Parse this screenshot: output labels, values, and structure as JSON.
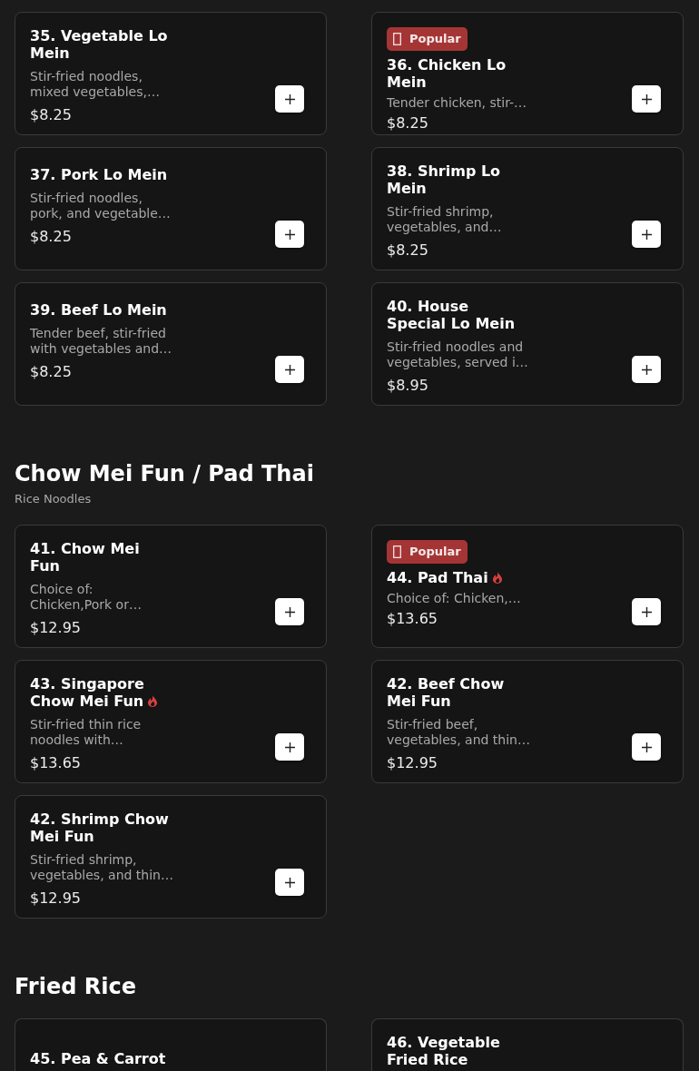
{
  "sections": [
    {
      "items": [
        {
          "name": "35. Vegetable Lo Mein",
          "description": "Stir-fried noodles, mixed vegetables,…",
          "price": "$8.25",
          "spicy": false
        },
        {
          "badge": "Popular",
          "name": "36. Chicken Lo Mein",
          "description": "Tender chicken, stir-…",
          "price": "$8.25",
          "spicy": false
        },
        {
          "name": "37. Pork Lo Mein",
          "description": "Stir-fried noodles, pork, and vegetable…",
          "price": "$8.25",
          "spicy": false
        },
        {
          "name": "38. Shrimp Lo Mein",
          "description": "Stir-fried shrimp, vegetables, and…",
          "price": "$8.25",
          "spicy": false
        },
        {
          "name": "39. Beef Lo Mein",
          "description": "Tender beef, stir-fried with vegetables and…",
          "price": "$8.25",
          "spicy": false
        },
        {
          "name": "40. House Special Lo Mein",
          "description": "Stir-fried noodles and vegetables, served i…",
          "price": "$8.95",
          "spicy": false
        }
      ]
    },
    {
      "title": "Chow Mei Fun / Pad Thai",
      "subtitle": "Rice Noodles",
      "items": [
        {
          "name": "41. Chow Mei Fun",
          "description": "Choice of: Chicken,Pork or…",
          "price": "$12.95",
          "spicy": false
        },
        {
          "badge": "Popular",
          "name": "44. Pad Thai",
          "description": "Choice of: Chicken,…",
          "price": "$13.65",
          "spicy": true
        },
        {
          "name": "43. Singapore Chow Mei Fun",
          "description": "Stir-fried thin rice noodles with…",
          "price": "$13.65",
          "spicy": true
        },
        {
          "name": "42. Beef Chow Mei Fun",
          "description": "Stir-fried beef, vegetables, and thin…",
          "price": "$12.95",
          "spicy": false
        },
        {
          "name": "42. Shrimp Chow Mei Fun",
          "description": "Stir-fried shrimp, vegetables, and thin…",
          "price": "$12.95",
          "spicy": false
        }
      ]
    },
    {
      "title": "Fried Rice",
      "items": [
        {
          "name": "45. Pea & Carrot",
          "spicy": false
        },
        {
          "name": "46. Vegetable Fried Rice",
          "spicy": false
        }
      ]
    }
  ]
}
